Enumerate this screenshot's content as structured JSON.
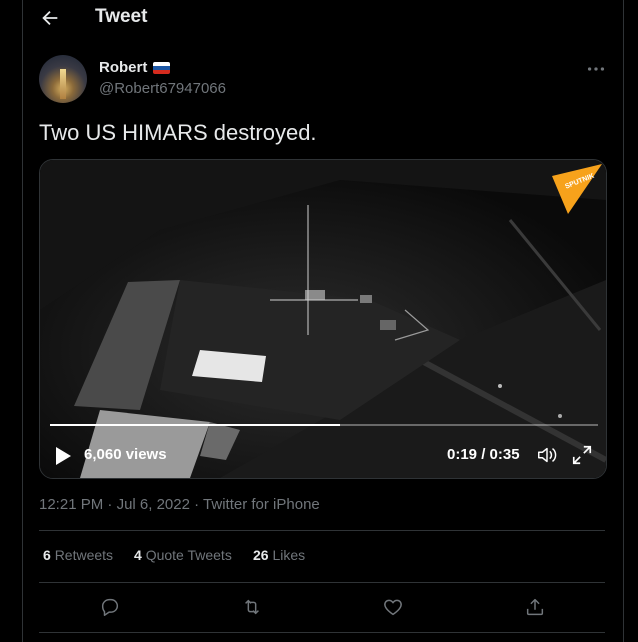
{
  "header": {
    "title": "Tweet",
    "back_icon": "arrow-left-icon"
  },
  "author": {
    "display_name": "Robert",
    "flag": "russia-flag-icon",
    "handle": "@Robert67947066",
    "more_icon": "more-horizontal-icon"
  },
  "tweet": {
    "text": "Two US HIMARS destroyed."
  },
  "media": {
    "watermark": "SPUTNIK",
    "views": "6,060 views",
    "time": "0:19 / 0:35",
    "progress": 0.53,
    "icons": [
      "play-icon",
      "volume-icon",
      "fullscreen-icon"
    ]
  },
  "meta": {
    "time": "12:21 PM",
    "date": "Jul 6, 2022",
    "source": "Twitter for iPhone"
  },
  "stats": {
    "retweets_count": "6",
    "retweets_label": "Retweets",
    "quotes_count": "4",
    "quotes_label": "Quote Tweets",
    "likes_count": "26",
    "likes_label": "Likes"
  },
  "actions": [
    "reply-icon",
    "retweet-icon",
    "like-icon",
    "share-icon"
  ],
  "colors": {
    "background": "#000000",
    "text": "#e7e9ea",
    "secondary": "#71767b",
    "border": "#2f3336",
    "sputnik": "#f7a21b"
  }
}
